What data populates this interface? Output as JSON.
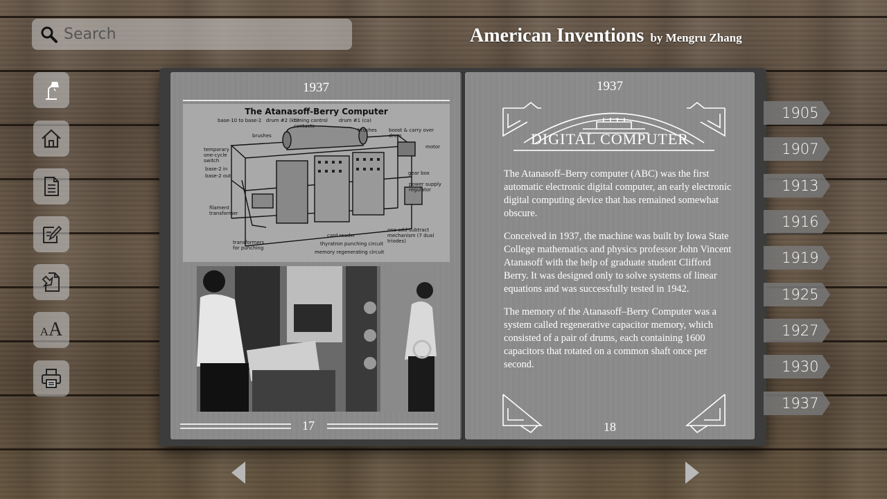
{
  "search": {
    "placeholder": "Search"
  },
  "header": {
    "title": "American Inventions",
    "byline": "by Mengru Zhang"
  },
  "sidebar": {
    "items": [
      {
        "icon": "lamp-icon"
      },
      {
        "icon": "home-icon"
      },
      {
        "icon": "document-icon"
      },
      {
        "icon": "edit-icon"
      },
      {
        "icon": "download-icon"
      },
      {
        "icon": "font-size-icon",
        "label_small": "A",
        "label_big": "A"
      },
      {
        "icon": "print-icon"
      }
    ]
  },
  "left_page": {
    "year": "1937",
    "page_number": "17",
    "diagram": {
      "title": "The Atanasoff-Berry Computer",
      "labels": [
        "base-10 to base-2",
        "drum #2 (kb)",
        "timing control contacts",
        "drum #1 (ca)",
        "brushes",
        "brushes",
        "boost & carry over drum",
        "motor",
        "temporary one-cycle switch",
        "base-2 in",
        "base-2 out",
        "gear box",
        "power supply regulator",
        "filament transformer",
        "card reader",
        "one add-subtract mechanism (7 dual triodes)",
        "transformers for punching",
        "thyratron punching circuit",
        "memory regenerating circuit"
      ]
    }
  },
  "right_page": {
    "year": "1937",
    "heading": "DIGITAL COMPUTER",
    "page_number": "18",
    "paragraphs": [
      "The Atanasoff–Berry computer (ABC) was the first automatic electronic digital computer, an early electronic digital computing device that has remained somewhat obscure.",
      "Conceived in 1937, the machine was built by Iowa State College mathematics and physics professor John Vincent Atanasoff with the help of graduate student Clifford Berry. It was designed only to solve systems of linear equations and was successfully tested in 1942.",
      "The memory of the Atanasoff–Berry Computer was a system called regenerative capacitor memory, which consisted of a pair of drums, each containing 1600 capacitors that rotated on a common shaft once per second."
    ]
  },
  "year_tabs": [
    "1905",
    "1907",
    "1913",
    "1916",
    "1919",
    "1925",
    "1927",
    "1930",
    "1937"
  ]
}
